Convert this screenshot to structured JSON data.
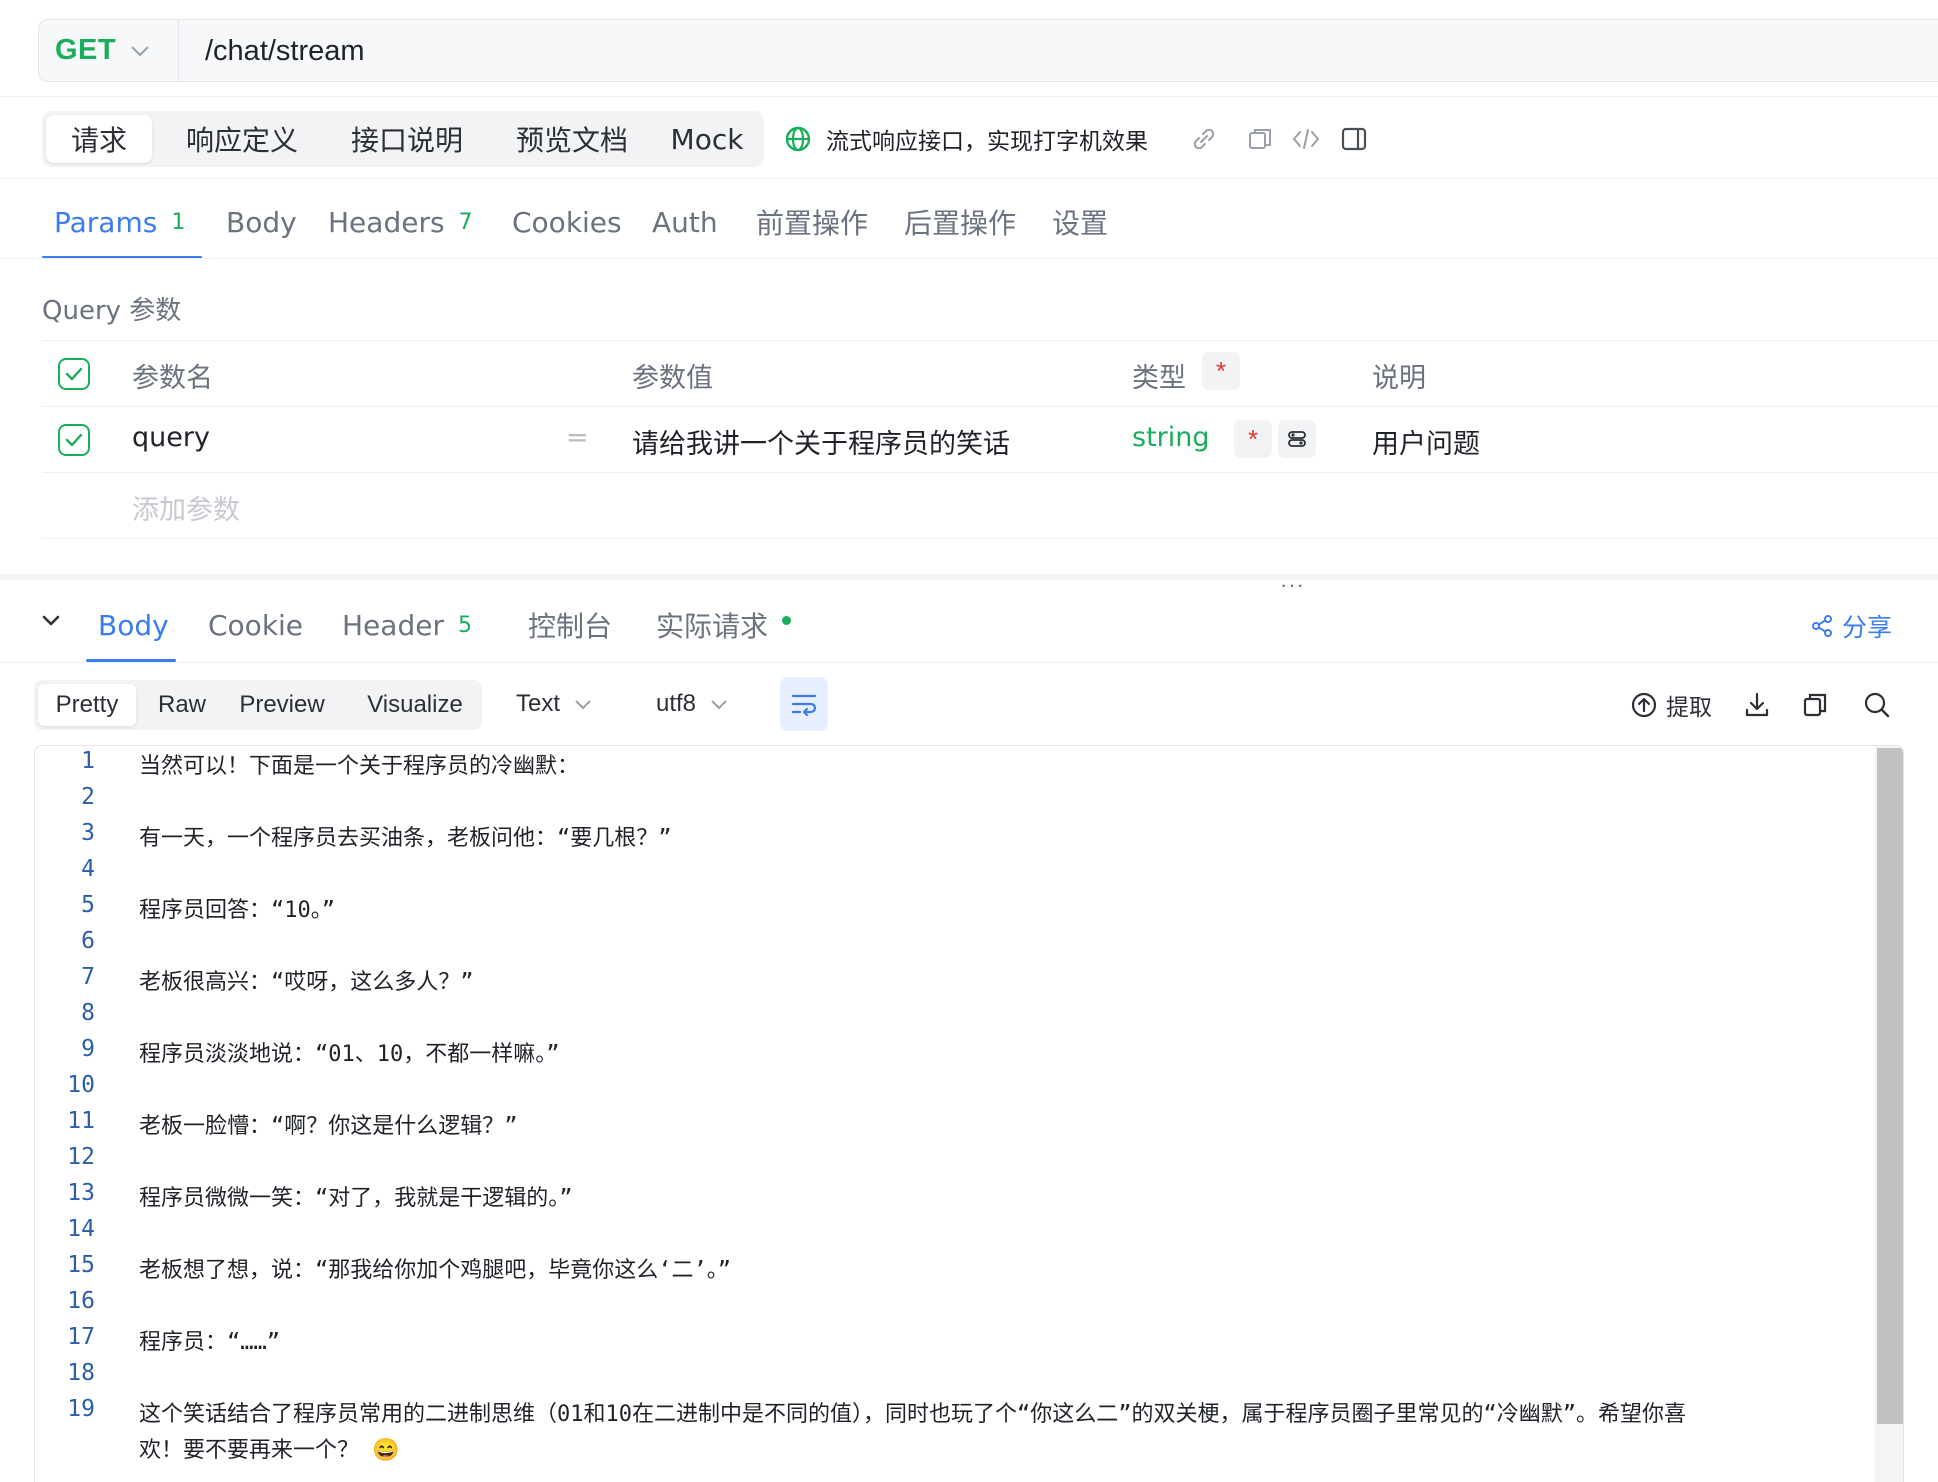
{
  "request": {
    "method": "GET",
    "url": "/chat/stream"
  },
  "top_tabs": [
    {
      "label": "请求",
      "active": true
    },
    {
      "label": "响应定义",
      "active": false
    },
    {
      "label": "接口说明",
      "active": false
    },
    {
      "label": "预览文档",
      "active": false
    },
    {
      "label": "Mock",
      "active": false
    }
  ],
  "api_description": "流式响应接口，实现打字机效果",
  "toolbar_icons": [
    "globe-icon",
    "link-icon",
    "copy-icon",
    "code-icon",
    "panel-icon"
  ],
  "request_tabs": [
    {
      "label": "Params",
      "badge": "1",
      "active": true
    },
    {
      "label": "Body"
    },
    {
      "label": "Headers",
      "badge": "7"
    },
    {
      "label": "Cookies"
    },
    {
      "label": "Auth"
    },
    {
      "label": "前置操作"
    },
    {
      "label": "后置操作"
    },
    {
      "label": "设置"
    }
  ],
  "params": {
    "section_title": "Query 参数",
    "columns": {
      "name": "参数名",
      "value": "参数值",
      "type": "类型",
      "required_mark": "*",
      "description": "说明"
    },
    "rows": [
      {
        "enabled": true,
        "name": "query",
        "equals": "=",
        "value": "请给我讲一个关于程序员的笑话",
        "type": "string",
        "required": "*",
        "description": "用户问题"
      }
    ],
    "add_placeholder": "添加参数"
  },
  "splitter_handle": "···",
  "response_tabs": [
    {
      "label": "Body",
      "active": true
    },
    {
      "label": "Cookie"
    },
    {
      "label": "Header",
      "badge": "5"
    },
    {
      "label": "控制台"
    },
    {
      "label": "实际请求",
      "dot": true
    }
  ],
  "share_label": "分享",
  "response_toolbar": {
    "formats": [
      {
        "label": "Pretty",
        "active": true
      },
      {
        "label": "Raw"
      },
      {
        "label": "Preview"
      },
      {
        "label": "Visualize"
      }
    ],
    "content_type": "Text",
    "encoding": "utf8",
    "extract_label": "提取"
  },
  "code_lines": [
    {
      "n": "1",
      "text": "当然可以！下面是一个关于程序员的冷幽默："
    },
    {
      "n": "2",
      "text": ""
    },
    {
      "n": "3",
      "text": "有一天，一个程序员去买油条，老板问他：“要几根？”"
    },
    {
      "n": "4",
      "text": ""
    },
    {
      "n": "5",
      "text": "程序员回答：“10。”"
    },
    {
      "n": "6",
      "text": ""
    },
    {
      "n": "7",
      "text": "老板很高兴：“哎呀，这么多人？”"
    },
    {
      "n": "8",
      "text": ""
    },
    {
      "n": "9",
      "text": "程序员淡淡地说：“01、10，不都一样嘛。”"
    },
    {
      "n": "10",
      "text": ""
    },
    {
      "n": "11",
      "text": "老板一脸懵：“啊？你这是什么逻辑？”"
    },
    {
      "n": "12",
      "text": ""
    },
    {
      "n": "13",
      "text": "程序员微微一笑：“对了，我就是干逻辑的。”"
    },
    {
      "n": "14",
      "text": ""
    },
    {
      "n": "15",
      "text": "老板想了想，说：“那我给你加个鸡腿吧，毕竟你这么‘二’。”"
    },
    {
      "n": "16",
      "text": ""
    },
    {
      "n": "17",
      "text": "程序员：“……”"
    },
    {
      "n": "18",
      "text": ""
    },
    {
      "n": "19",
      "text": "这个笑话结合了程序员常用的二进制思维（01和10在二进制中是不同的值），同时也玩了个“你这么二”的双关梗，属于程序员圈子里常见的“冷幽默”。希望你喜",
      "cont": "欢！要不要再来一个？ 😄"
    }
  ],
  "colors": {
    "accent": "#3b7cf0",
    "method_green": "#1aad5c",
    "required_red": "#e5372c"
  }
}
